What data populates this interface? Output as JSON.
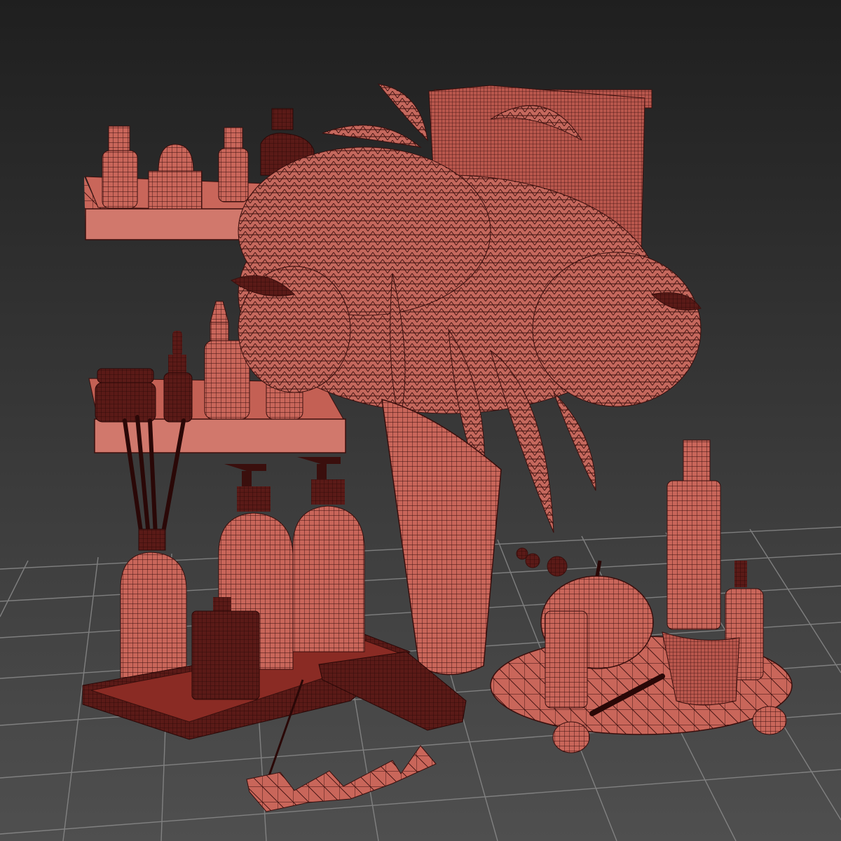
{
  "scene": {
    "kind": "3D viewport wireframe render",
    "objects": [
      "wall-shelves",
      "reed-diffuser",
      "soap-dispensers",
      "candle",
      "tray",
      "vase-with-dried-flowers",
      "towel",
      "cosmetic-bottles",
      "pumpkin",
      "round-stand",
      "incense-holder",
      "brush"
    ]
  },
  "colors": {
    "background_top": "#1f1f1f",
    "background_bottom": "#4a4a4a",
    "grid": "#8a8a8a",
    "mesh_fill": "#c9665a",
    "mesh_dark": "#4a1614",
    "wire": "#3a0f0d"
  }
}
